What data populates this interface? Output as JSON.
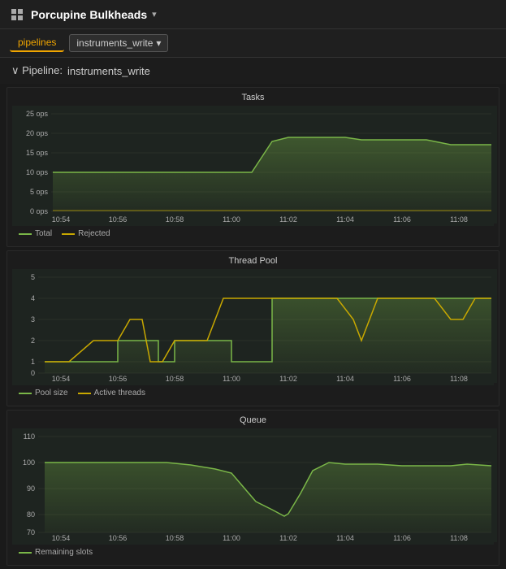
{
  "header": {
    "title": "Porcupine Bulkheads",
    "arrow": "▾",
    "icon": "grid"
  },
  "tabs": {
    "active": "pipelines",
    "active_label": "pipelines",
    "dropdown_label": "instruments_write",
    "dropdown_arrow": "▾"
  },
  "pipeline": {
    "prefix": "∨ Pipeline:",
    "name": "instruments_write"
  },
  "charts": {
    "tasks": {
      "title": "Tasks",
      "y_labels": [
        "25 ops",
        "20 ops",
        "15 ops",
        "10 ops",
        "5 ops",
        "0 ops"
      ],
      "x_labels": [
        "10:54",
        "10:56",
        "10:58",
        "11:00",
        "11:02",
        "11:04",
        "11:06",
        "11:08"
      ],
      "legend": [
        {
          "label": "Total",
          "color": "#7ab648"
        },
        {
          "label": "Rejected",
          "color": "#c8a800"
        }
      ]
    },
    "threadpool": {
      "title": "Thread Pool",
      "y_labels": [
        "5",
        "4",
        "3",
        "2",
        "1",
        "0"
      ],
      "x_labels": [
        "10:54",
        "10:56",
        "10:58",
        "11:00",
        "11:02",
        "11:04",
        "11:06",
        "11:08"
      ],
      "legend": [
        {
          "label": "Pool size",
          "color": "#7ab648"
        },
        {
          "label": "Active threads",
          "color": "#c8a800"
        }
      ]
    },
    "queue": {
      "title": "Queue",
      "y_labels": [
        "110",
        "100",
        "90",
        "80",
        "70"
      ],
      "x_labels": [
        "10:54",
        "10:56",
        "10:58",
        "11:00",
        "11:02",
        "11:04",
        "11:06",
        "11:08"
      ],
      "legend": [
        {
          "label": "Remaining slots",
          "color": "#7ab648"
        }
      ]
    }
  }
}
